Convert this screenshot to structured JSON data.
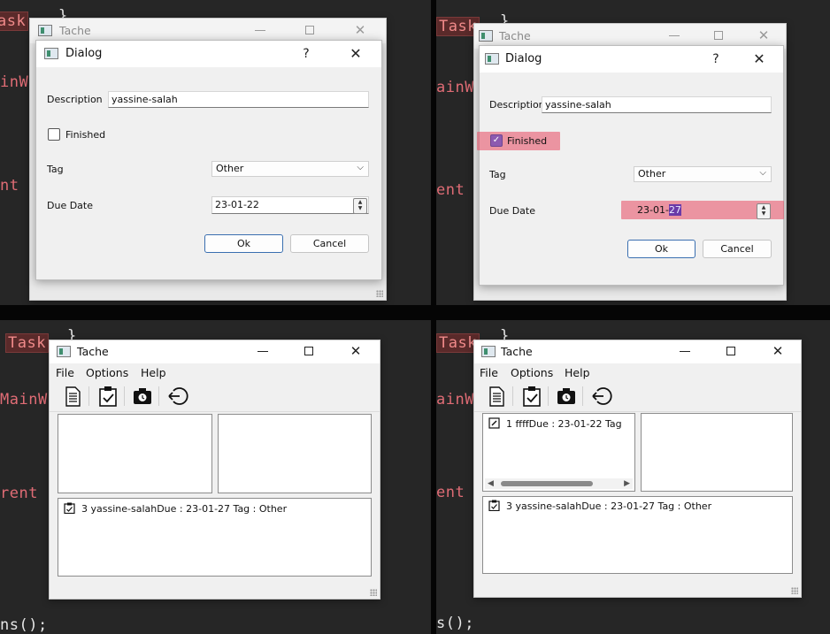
{
  "code": {
    "left": [
      "ask",
      "inW",
      "nt",
      "ns();"
    ],
    "right": [
      "Task",
      "ainW",
      "ent",
      "s();"
    ],
    "bottom_left": [
      "Task",
      "MainW",
      "rent"
    ],
    "bottom_right": [
      "Task",
      "ainW",
      "ent"
    ],
    "brace": "}"
  },
  "main_window": {
    "title": "Tache"
  },
  "dialog": {
    "title": "Dialog",
    "help": "?",
    "close": "✕"
  },
  "form": {
    "description_label": "Description",
    "finished_label": "Finished",
    "tag_label": "Tag",
    "due_date_label": "Due Date",
    "ok": "Ok",
    "cancel": "Cancel"
  },
  "panel1": {
    "description_value": "yassine-salah",
    "finished_checked": false,
    "tag_value": "Other",
    "due_date": "23-01-22"
  },
  "panel2": {
    "description_value": "yassine-salah",
    "finished_checked": true,
    "tag_value": "Other",
    "due_date_prefix": "23-01-",
    "due_date_selected": "27"
  },
  "menu": {
    "file": "File",
    "options": "Options",
    "help": "Help"
  },
  "toolbar_icons": [
    "document-icon",
    "checklist-icon",
    "camera-icon",
    "back-arrow-icon"
  ],
  "panel3": {
    "bottom_item": "3 yassine-salahDue : 23-01-27 Tag : Other"
  },
  "panel4": {
    "top_item": "1 ffffDue : 23-01-22 Tag",
    "bottom_item": "3 yassine-salahDue : 23-01-27 Tag : Other"
  },
  "colors": {
    "highlight": "#e84860",
    "check_accent": "#8c5ab0",
    "code_red": "#e06c75"
  }
}
